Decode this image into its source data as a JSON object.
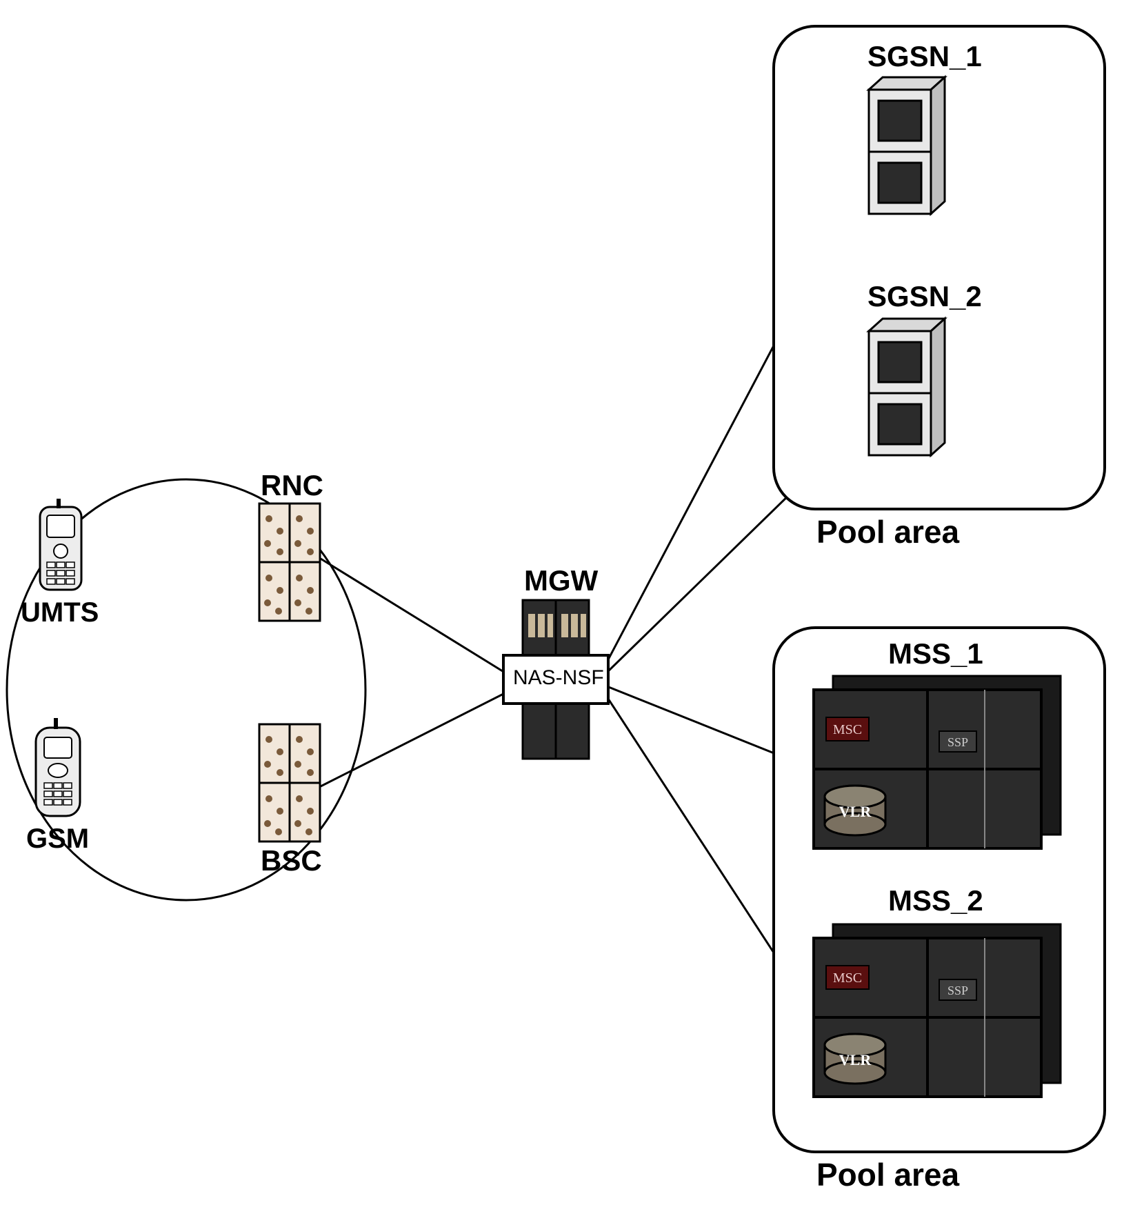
{
  "nodes": {
    "umts": {
      "label": "UMTS"
    },
    "gsm": {
      "label": "GSM"
    },
    "rnc": {
      "label": "RNC"
    },
    "bsc": {
      "label": "BSC"
    },
    "mgw": {
      "label": "MGW"
    },
    "nas_nsf": {
      "label": "NAS-NSF"
    },
    "sgsn1": {
      "label": "SGSN_1"
    },
    "sgsn2": {
      "label": "SGSN_2"
    },
    "mss1": {
      "label": "MSS_1"
    },
    "mss2": {
      "label": "MSS_2"
    },
    "mss_inner_msc": "MSC",
    "mss_inner_ssp": "SSP",
    "mss_inner_vlr": "VLR"
  },
  "groups": {
    "pool_top": "Pool area",
    "pool_bottom": "Pool area"
  }
}
